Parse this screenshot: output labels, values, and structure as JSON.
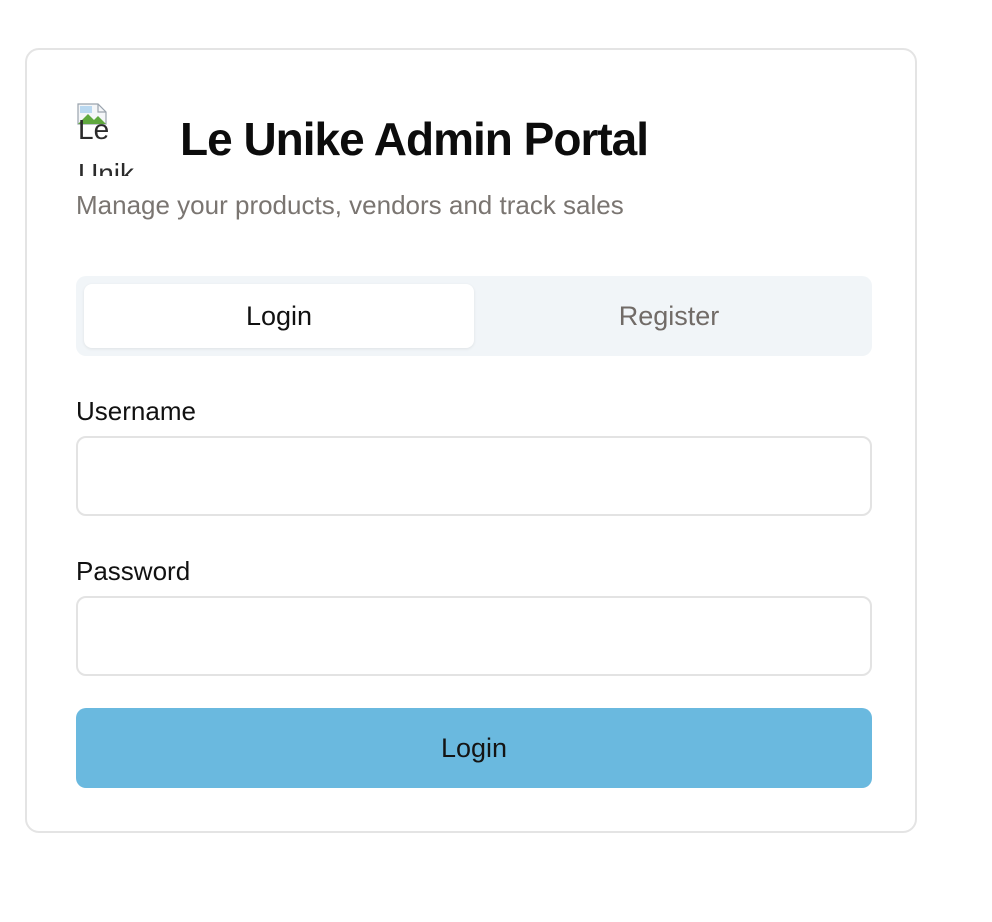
{
  "header": {
    "logo_alt": "Le Unike",
    "title": "Le Unike Admin Portal",
    "subtitle": "Manage your products, vendors and track sales"
  },
  "tabs": [
    {
      "label": "Login",
      "active": true
    },
    {
      "label": "Register",
      "active": false
    }
  ],
  "form": {
    "username_label": "Username",
    "username_value": "",
    "password_label": "Password",
    "password_value": "",
    "submit_label": "Login"
  },
  "colors": {
    "primary_button": "#6ab9df",
    "tabs_background": "#f1f5f8",
    "muted_text": "#7a7571"
  }
}
